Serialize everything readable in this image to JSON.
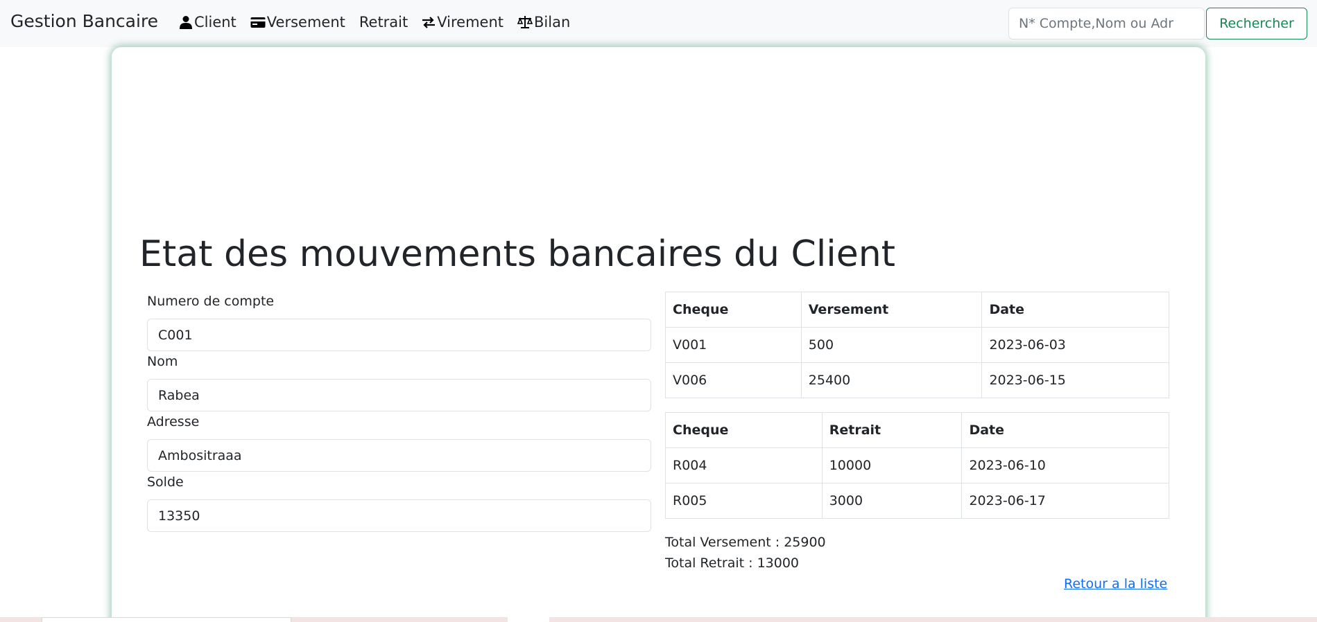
{
  "navbar": {
    "brand": "Gestion Bancaire",
    "links": [
      {
        "label": "Client",
        "icon": "user-icon"
      },
      {
        "label": "Versement",
        "icon": "credit-card-icon"
      },
      {
        "label": "Retrait",
        "icon": ""
      },
      {
        "label": "Virement",
        "icon": "arrows-exchange-icon"
      },
      {
        "label": "Bilan",
        "icon": "scale-icon"
      }
    ],
    "search_placeholder": "N* Compte,Nom ou Adr",
    "search_button": "Rechercher"
  },
  "page": {
    "title": "Etat des mouvements bancaires du Client"
  },
  "client": {
    "account_label": "Numero de compte",
    "account_value": "C001",
    "name_label": "Nom",
    "name_value": "Rabea",
    "address_label": "Adresse",
    "address_value": "Ambositraaa",
    "balance_label": "Solde",
    "balance_value": "13350"
  },
  "versements": {
    "headers": [
      "Cheque",
      "Versement",
      "Date"
    ],
    "rows": [
      [
        "V001",
        "500",
        "2023-06-03"
      ],
      [
        "V006",
        "25400",
        "2023-06-15"
      ]
    ]
  },
  "retraits": {
    "headers": [
      "Cheque",
      "Retrait",
      "Date"
    ],
    "rows": [
      [
        "R004",
        "10000",
        "2023-06-10"
      ],
      [
        "R005",
        "3000",
        "2023-06-17"
      ]
    ]
  },
  "totals": {
    "versement": "Total Versement : 25900",
    "retrait": "Total Retrait : 13000"
  },
  "back_link": "Retour a la liste",
  "colors": {
    "accent_green": "#198754",
    "link_blue": "#0d6efd"
  }
}
